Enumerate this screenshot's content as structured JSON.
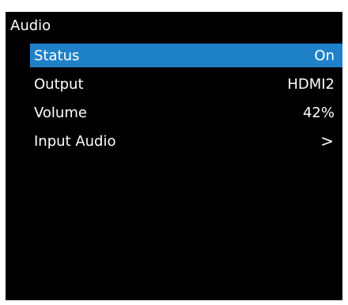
{
  "menu": {
    "title": "Audio",
    "selected_color": "#1f82c9",
    "items": [
      {
        "label": "Status",
        "value": "On",
        "selected": true
      },
      {
        "label": "Output",
        "value": "HDMI2",
        "selected": false
      },
      {
        "label": "Volume",
        "value": "42%",
        "selected": false
      },
      {
        "label": "Input Audio",
        "value": ">",
        "icon": "chevron-right-icon",
        "selected": false
      }
    ]
  }
}
